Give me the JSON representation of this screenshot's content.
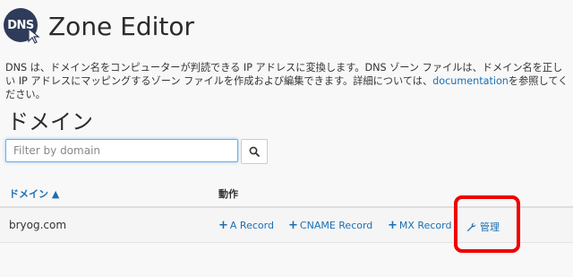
{
  "header": {
    "logo_text": "DNS",
    "title": "Zone Editor"
  },
  "description": {
    "text_before_link": "DNS は、ドメイン名をコンピューターが判読できる IP アドレスに変換します。DNS ゾーン ファイルは、ドメイン名を正しい IP アドレスにマッピングするゾーン ファイルを作成および編集できます。詳細については、",
    "link_text": "documentation",
    "text_after_link": "を参照してください。"
  },
  "section": {
    "title": "ドメイン"
  },
  "filter": {
    "placeholder": "Filter by domain",
    "value": ""
  },
  "table": {
    "columns": {
      "domain": "ドメイン ▲",
      "actions": "動作"
    },
    "rows": [
      {
        "domain": "bryog.com",
        "actions": {
          "a_record": "A Record",
          "cname_record": "CNAME Record",
          "mx_record": "MX Record",
          "manage": "管理"
        }
      }
    ]
  },
  "colors": {
    "link": "#1a6fb5",
    "highlight": "#f00000",
    "logo_bg": "#2f3b5a"
  },
  "icons": {
    "search": "search-icon",
    "wrench": "wrench-icon",
    "plus": "plus-icon",
    "logo": "dns-logo-icon"
  }
}
